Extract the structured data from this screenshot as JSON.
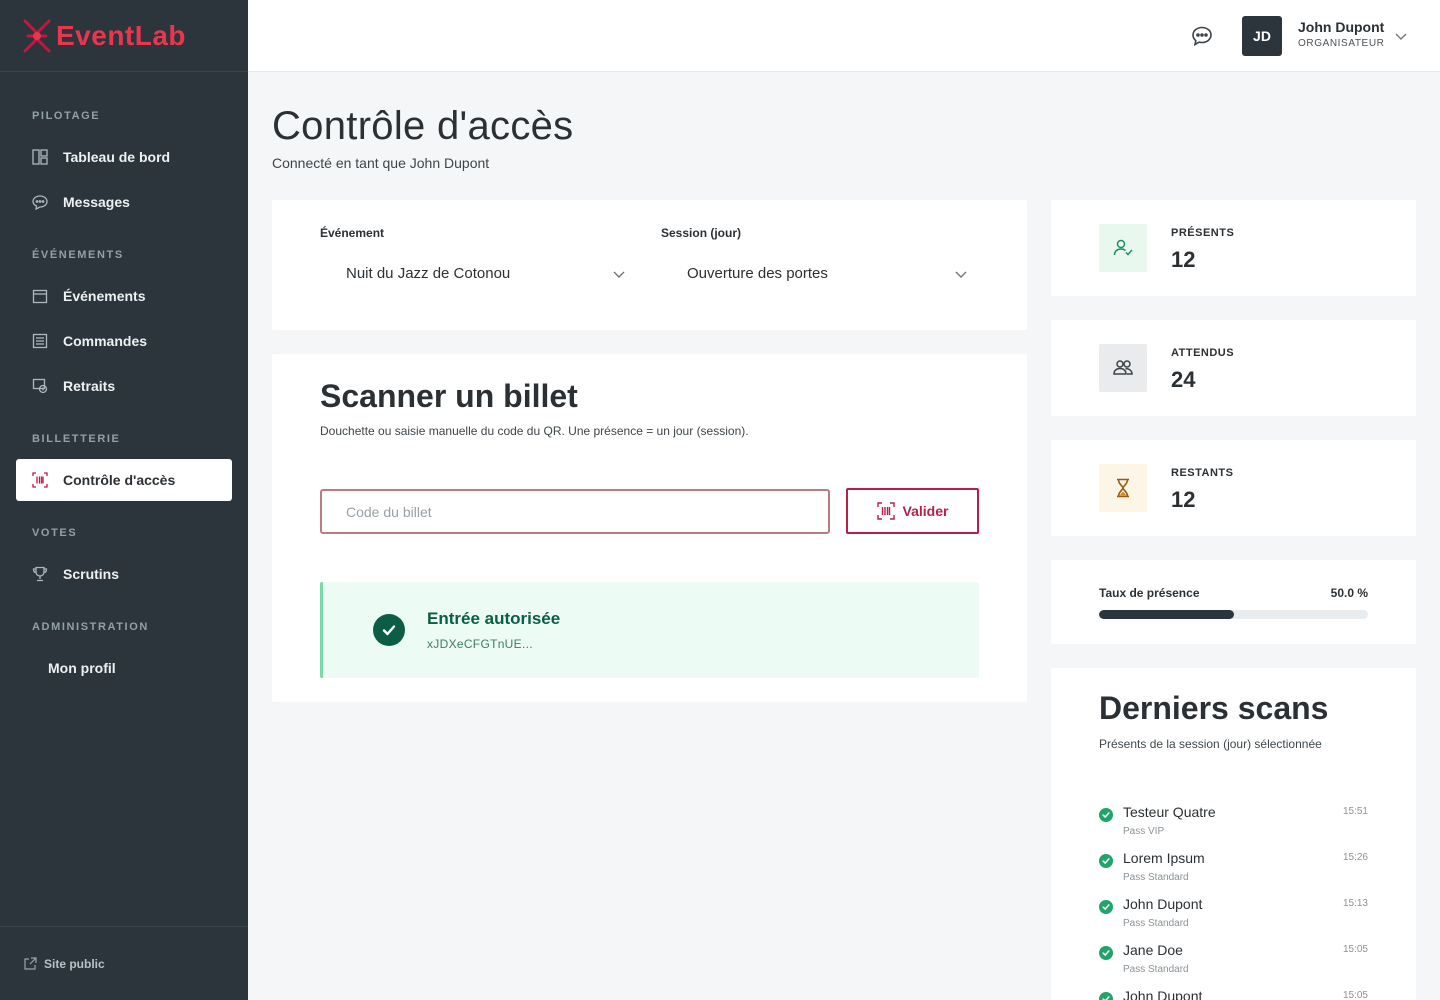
{
  "brand": {
    "name": "EventLab"
  },
  "sidebar": {
    "sections": [
      {
        "title": "PILOTAGE",
        "items": [
          {
            "label": "Tableau de bord",
            "icon": "dashboard-icon"
          },
          {
            "label": "Messages",
            "icon": "chat-icon"
          }
        ]
      },
      {
        "title": "ÉVÉNEMENTS",
        "items": [
          {
            "label": "Événements",
            "icon": "calendar-icon"
          },
          {
            "label": "Commandes",
            "icon": "orders-icon"
          },
          {
            "label": "Retraits",
            "icon": "withdraw-icon"
          }
        ]
      },
      {
        "title": "BILLETTERIE",
        "items": [
          {
            "label": "Contrôle d'accès",
            "icon": "barcode-scan-icon",
            "active": true
          }
        ]
      },
      {
        "title": "VOTES",
        "items": [
          {
            "label": "Scrutins",
            "icon": "trophy-icon"
          }
        ]
      },
      {
        "title": "ADMINISTRATION",
        "items": [
          {
            "label": "Mon profil"
          }
        ]
      }
    ],
    "footer_link": "Site public"
  },
  "topbar": {
    "user": {
      "initials": "JD",
      "name": "John Dupont",
      "role": "ORGANISATEUR"
    }
  },
  "page": {
    "title": "Contrôle d'accès",
    "subtitle": "Connecté en tant que John Dupont"
  },
  "filters": {
    "event_label": "Événement",
    "event_value": "Nuit du Jazz de Cotonou",
    "session_label": "Session (jour)",
    "session_value": "Ouverture des portes"
  },
  "scanner": {
    "title": "Scanner un billet",
    "description": "Douchette ou saisie manuelle du code du QR. Une présence = un jour (session).",
    "input_placeholder": "Code du billet",
    "input_value": "",
    "validate_label": "Valider",
    "result_title": "Entrée autorisée",
    "result_code": "xJDXeCFGTnUE..."
  },
  "stats": {
    "present_label": "PRÉSENTS",
    "present_value": "12",
    "expected_label": "ATTENDUS",
    "expected_value": "24",
    "remaining_label": "RESTANTS",
    "remaining_value": "12"
  },
  "attendance": {
    "label": "Taux de présence",
    "value_text": "50.0 %",
    "fraction": 0.5
  },
  "recent": {
    "title": "Derniers scans",
    "subtitle": "Présents de la session (jour) sélectionnée",
    "items": [
      {
        "name": "Testeur Quatre",
        "pass": "Pass VIP",
        "time": "15:51"
      },
      {
        "name": "Lorem Ipsum",
        "pass": "Pass Standard",
        "time": "15:26"
      },
      {
        "name": "John Dupont",
        "pass": "Pass Standard",
        "time": "15:13"
      },
      {
        "name": "Jane Doe",
        "pass": "Pass Standard",
        "time": "15:05"
      },
      {
        "name": "John Dupont",
        "pass": "",
        "time": "15:05"
      }
    ]
  },
  "colors": {
    "sidebar_bg": "#2b353b",
    "accent": "#b71f48",
    "success": "#0b5e45",
    "success_bg": "#ecfbf4"
  }
}
